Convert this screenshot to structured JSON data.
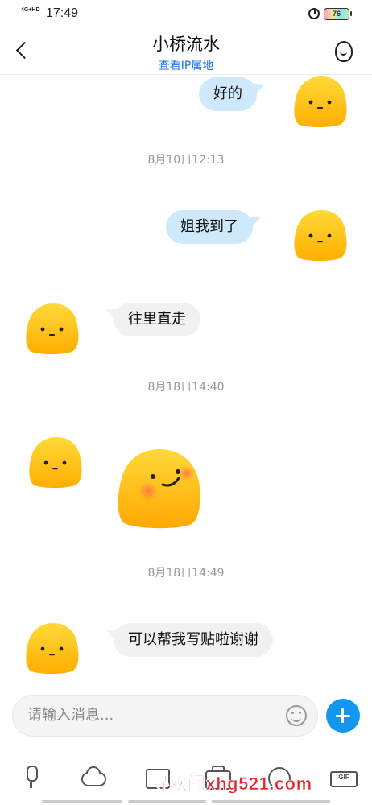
{
  "status_bar": {
    "network": "4G+HD",
    "time": "17:49",
    "battery": "76"
  },
  "header": {
    "title": "小桥流水",
    "subtitle": "查看IP属地"
  },
  "messages": [
    {
      "type": "out",
      "text": "好的"
    },
    {
      "type": "time",
      "text": "8月10日12:13"
    },
    {
      "type": "out",
      "text": "姐我到了"
    },
    {
      "type": "in",
      "text": "往里直走"
    },
    {
      "type": "time",
      "text": "8月18日14:40"
    },
    {
      "type": "in_sticker",
      "sticker": "smiling-blush-sticker"
    },
    {
      "type": "time",
      "text": "8月18日14:49"
    },
    {
      "type": "in",
      "text": "可以帮我写贴啦谢谢"
    }
  ],
  "input": {
    "placeholder": "请输入消息..."
  },
  "toolbar": {
    "icons": [
      "mic-icon",
      "cloud-icon",
      "image-icon",
      "camera-icon",
      "red-packet-icon",
      "gif-video-icon"
    ]
  },
  "watermark": "寻欢阁xhg521.com",
  "colors": {
    "accent": "#1296ee",
    "link": "#1a73e8",
    "outgoing_bubble": "#cde9fb",
    "incoming_bubble": "#f1f1f1",
    "avatar_yellow": "#ffc400",
    "watermark": "#e8232b"
  }
}
